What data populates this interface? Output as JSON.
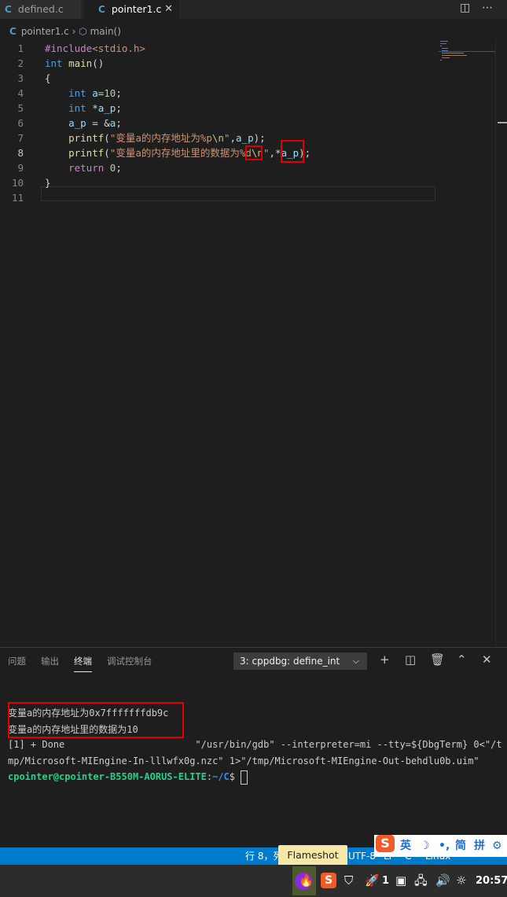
{
  "tabs": [
    {
      "icon": "C",
      "label": "defined.c"
    },
    {
      "icon": "C",
      "label": "pointer1.c",
      "close": "✕"
    }
  ],
  "breadcrumb": {
    "file": "pointer1.c",
    "sep": "›",
    "symbol": "main()"
  },
  "editor": {
    "line_numbers": [
      "1",
      "2",
      "3",
      "4",
      "5",
      "6",
      "7",
      "8",
      "9",
      "10",
      "11"
    ],
    "lines": [
      [
        {
          "t": "#include",
          "c": "ctl"
        },
        {
          "t": "<stdio.h>",
          "c": "str"
        }
      ],
      [
        {
          "t": "int",
          "c": "kw"
        },
        {
          "t": " ",
          "c": "pl"
        },
        {
          "t": "main",
          "c": "fn"
        },
        {
          "t": "()",
          "c": "pl"
        }
      ],
      [
        {
          "t": "{",
          "c": "pl"
        }
      ],
      [
        {
          "t": "    ",
          "c": "pl"
        },
        {
          "t": "int",
          "c": "kw"
        },
        {
          "t": " ",
          "c": "pl"
        },
        {
          "t": "a",
          "c": "var"
        },
        {
          "t": "=",
          "c": "pl"
        },
        {
          "t": "10",
          "c": "num"
        },
        {
          "t": ";",
          "c": "pl"
        }
      ],
      [
        {
          "t": "    ",
          "c": "pl"
        },
        {
          "t": "int",
          "c": "kw"
        },
        {
          "t": " *",
          "c": "pl"
        },
        {
          "t": "a_p",
          "c": "var"
        },
        {
          "t": ";",
          "c": "pl"
        }
      ],
      [
        {
          "t": "    ",
          "c": "pl"
        },
        {
          "t": "a_p",
          "c": "var"
        },
        {
          "t": " = &",
          "c": "pl"
        },
        {
          "t": "a",
          "c": "var"
        },
        {
          "t": ";",
          "c": "pl"
        }
      ],
      [
        {
          "t": "    ",
          "c": "pl"
        },
        {
          "t": "printf",
          "c": "fn"
        },
        {
          "t": "(",
          "c": "pl"
        },
        {
          "t": "\"变量a的内存地址为%p",
          "c": "str"
        },
        {
          "t": "\\n",
          "c": "esc"
        },
        {
          "t": "\"",
          "c": "str"
        },
        {
          "t": ",",
          "c": "pl"
        },
        {
          "t": "a_p",
          "c": "var"
        },
        {
          "t": ");",
          "c": "pl"
        }
      ],
      [
        {
          "t": "    ",
          "c": "pl"
        },
        {
          "t": "printf",
          "c": "fn"
        },
        {
          "t": "(",
          "c": "pl"
        },
        {
          "t": "\"变量a的内存地址里的数据为%d",
          "c": "str"
        },
        {
          "t": "\\n",
          "c": "esc"
        },
        {
          "t": "\"",
          "c": "str"
        },
        {
          "t": ",",
          "c": "pl"
        },
        {
          "t": "*",
          "c": "pl"
        },
        {
          "t": "a_p",
          "c": "var"
        },
        {
          "t": ");",
          "c": "pl"
        }
      ],
      [
        {
          "t": "    ",
          "c": "pl"
        },
        {
          "t": "return",
          "c": "ctl"
        },
        {
          "t": " ",
          "c": "pl"
        },
        {
          "t": "0",
          "c": "num"
        },
        {
          "t": ";",
          "c": "pl"
        }
      ],
      [
        {
          "t": "}",
          "c": "pl"
        }
      ],
      []
    ]
  },
  "panel": {
    "tabs": [
      "问题",
      "输出",
      "终端",
      "调试控制台"
    ],
    "active_tab": "终端",
    "terminal_select": "3: cppdbg: define_int",
    "chevron": "⌵",
    "terminal": {
      "out1": "变量a的内存地址为0x7fffffffdb9c",
      "out2": "变量a的内存地址里的数据为10",
      "done1": "[1] + Done                       \"/usr/bin/gdb\" --interpreter=mi --tty=${DbgTerm} 0<\"/t",
      "done2": "mp/Microsoft-MIEngine-In-lllwfx0g.nzc\" 1>\"/tmp/Microsoft-MIEngine-Out-behdlu0b.uim\"",
      "prompt_user": "cpointer@cpointer-B550M-AORUS-ELITE",
      "prompt_sep": ":",
      "prompt_path": "~/C",
      "prompt_end": "$ "
    }
  },
  "statusbar": {
    "position": "行 8，列",
    "encoding": "UTF-8",
    "eol": "LF",
    "lang": "C",
    "os": "Linux"
  },
  "tooltip": "Flameshot",
  "ime": {
    "badge": "S",
    "lang": "英",
    "moon": "☽",
    "dots": "•,",
    "simp": "简",
    "pinyin": "拼",
    "gear": "⚙"
  },
  "taskbar": {
    "sogou": "S",
    "shield": "⛉",
    "notif_count": "1",
    "clock": "20:57"
  },
  "colors": {
    "statusbar": "#007acc",
    "redbox": "#e00000",
    "prompt_user": "#23d18b",
    "prompt_path": "#3b8eea"
  }
}
